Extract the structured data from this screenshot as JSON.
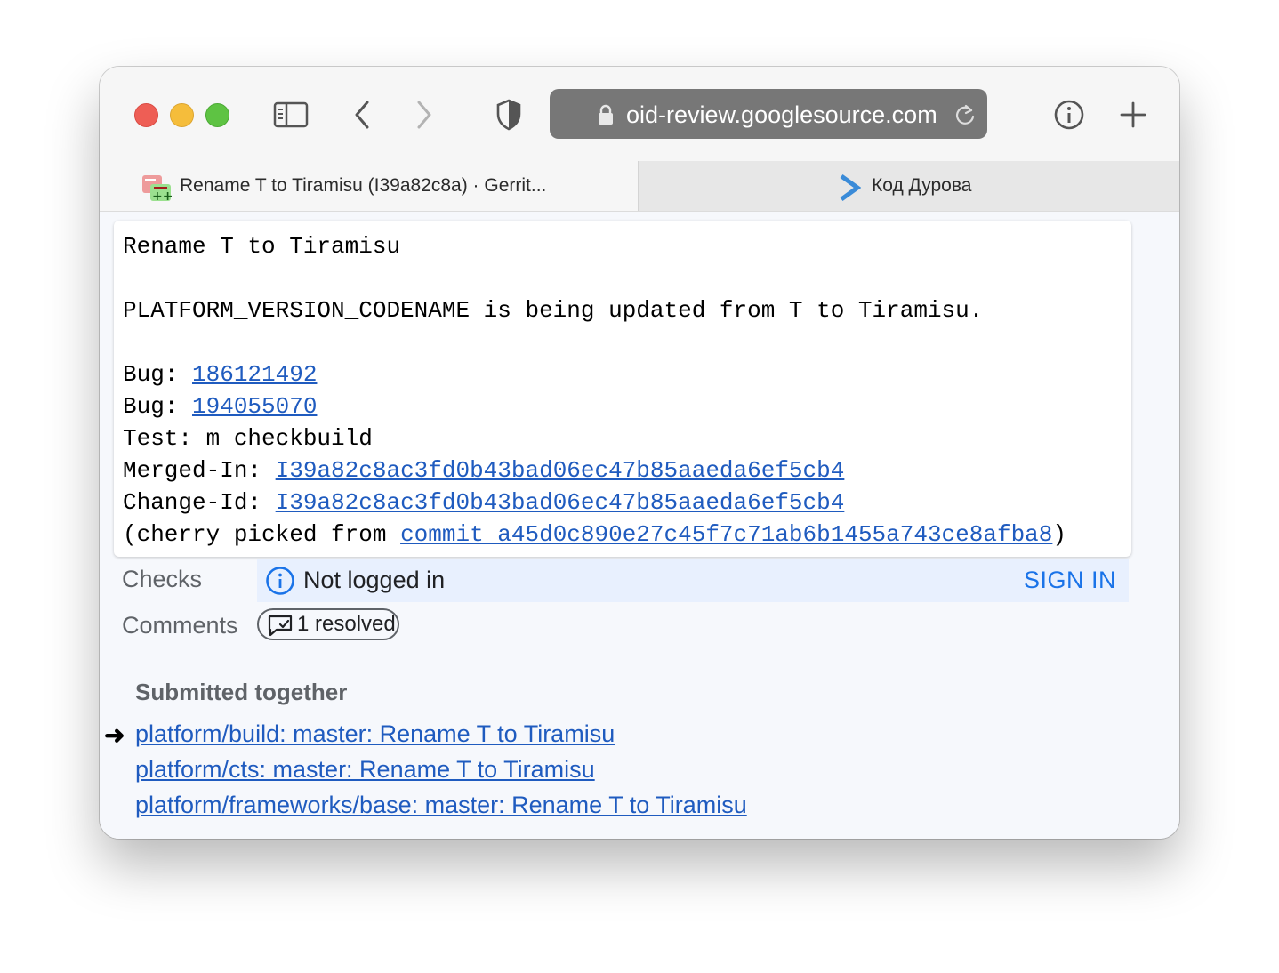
{
  "browser": {
    "url": "oid-review.googlesource.com",
    "tabs": [
      {
        "title": "Rename T to Tiramisu (I39a82c8a) · Gerrit..."
      },
      {
        "title": "Код Дурова"
      }
    ]
  },
  "commit_message": {
    "subject": "Rename T to Tiramisu",
    "body": "PLATFORM_VERSION_CODENAME is being updated from T to Tiramisu.",
    "bug_label": "Bug: ",
    "bugs": [
      "186121492",
      "194055070"
    ],
    "test_line": "Test: m checkbuild",
    "merged_in_label": "Merged-In: ",
    "merged_in_value": "I39a82c8ac3fd0b43bad06ec47b85aaeda6ef5cb4",
    "change_id_label": "Change-Id: ",
    "change_id_value": "I39a82c8ac3fd0b43bad06ec47b85aaeda6ef5cb4",
    "cherry_prefix": "(cherry picked from ",
    "cherry_link": "commit a45d0c890e27c45f7c71ab6b1455a743ce8afba8",
    "cherry_suffix": ")"
  },
  "checks": {
    "label": "Checks",
    "status": "Not logged in",
    "action": "SIGN IN"
  },
  "comments": {
    "label": "Comments",
    "chip": "1 resolved"
  },
  "submitted_together": {
    "title": "Submitted together",
    "arrow": "➜",
    "items": [
      "platform/build: master: Rename T to Tiramisu",
      "platform/cts: master: Rename T to Tiramisu",
      "platform/frameworks/base: master: Rename T to Tiramisu"
    ]
  },
  "colors": {
    "link": "#1f5bbf",
    "info_banner": "#e8f0fe",
    "sign_in": "#1a73e8"
  }
}
